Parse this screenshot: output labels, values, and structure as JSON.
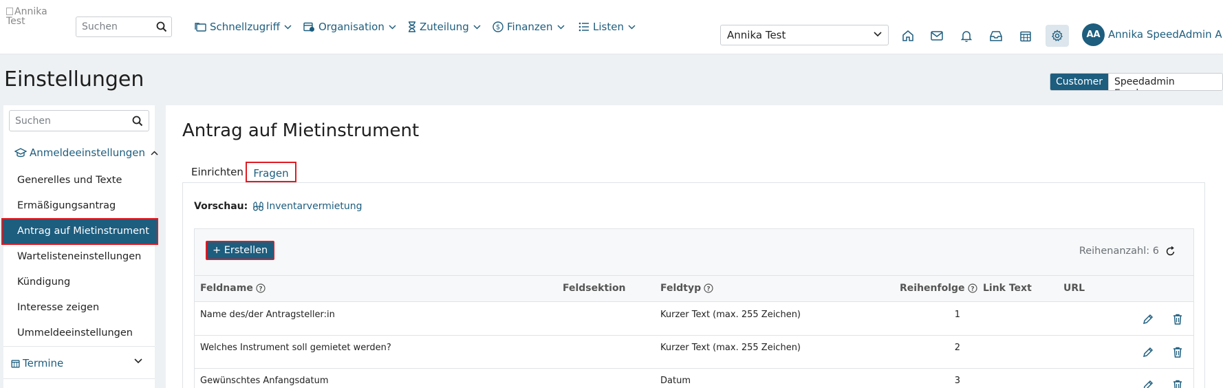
{
  "topbar": {
    "logo_alt": "Annika Test Kulturschule",
    "search_placeholder": "Suchen",
    "nav": [
      {
        "label": "Schnellzugriff",
        "icon": "folders-icon"
      },
      {
        "label": "Organisation",
        "icon": "calendar-clock-icon"
      },
      {
        "label": "Zuteilung",
        "icon": "hourglass-icon"
      },
      {
        "label": "Finanzen",
        "icon": "dollar-circle-icon"
      },
      {
        "label": "Listen",
        "icon": "list-icon"
      }
    ],
    "school_select": "Annika Test",
    "icons": [
      "home-icon",
      "mail-icon",
      "bell-icon",
      "inbox-icon",
      "calendar-icon",
      "gear-icon"
    ],
    "avatar_initials": "AA",
    "user_name": "Annika SpeedAdmin A..."
  },
  "page": {
    "title": "Einstellungen",
    "roles": {
      "customer": "Customer",
      "employee": "Speedadmin Employee"
    }
  },
  "sidebar": {
    "search_placeholder": "Suchen",
    "group": "Anmeldeeinstellungen",
    "items": [
      {
        "label": "Generelles und Texte"
      },
      {
        "label": "Ermäßigungsantrag"
      },
      {
        "label": "Antrag auf Mietinstrument",
        "active": true
      },
      {
        "label": "Wartelisteneinstellungen"
      },
      {
        "label": "Kündigung"
      },
      {
        "label": "Interesse zeigen"
      },
      {
        "label": "Ummeldeeinstellungen"
      }
    ],
    "group2": "Termine"
  },
  "main": {
    "title": "Antrag auf Mietinstrument",
    "tabs": {
      "setup": "Einrichten",
      "questions": "Fragen"
    },
    "preview_label": "Vorschau:",
    "preview_link": "Inventarvermietung",
    "create_button": "+ Erstellen",
    "row_count": "Reihenanzahl: 6",
    "columns": {
      "fieldname": "Feldname",
      "section": "Feldsektion",
      "type": "Feldtyp",
      "order": "Reihenfolge",
      "linktext": "Link Text",
      "url": "URL"
    },
    "rows": [
      {
        "fieldname": "Name des/der Antragsteller:in",
        "section": "",
        "type": "Kurzer Text (max. 255 Zeichen)",
        "order": "1"
      },
      {
        "fieldname": "Welches Instrument soll gemietet werden?",
        "section": "",
        "type": "Kurzer Text (max. 255 Zeichen)",
        "order": "2"
      },
      {
        "fieldname": "Gewünschtes Anfangsdatum",
        "section": "",
        "type": "Datum",
        "order": "3"
      }
    ]
  },
  "colors": {
    "primary": "#1d5d7e",
    "highlight": "#e01a22"
  }
}
